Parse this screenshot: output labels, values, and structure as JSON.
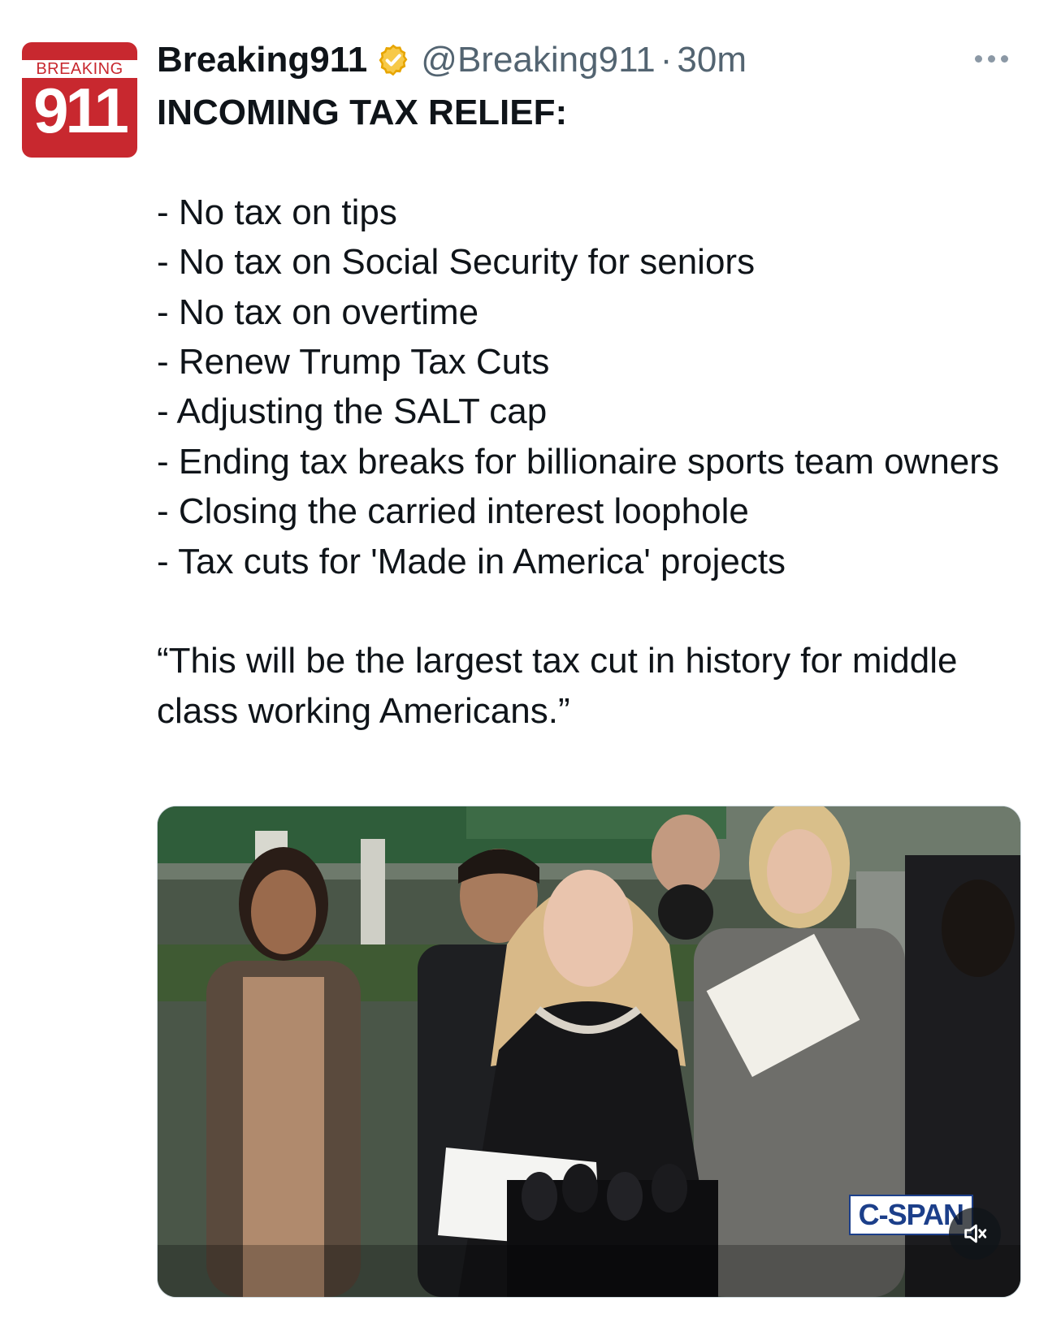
{
  "author": {
    "avatar_top": "BREAKING",
    "avatar_number": "911",
    "display_name": "Breaking911",
    "handle": "@Breaking911",
    "separator": "·",
    "time": "30m",
    "verified_color": "#f2b600"
  },
  "tweet": {
    "headline": "INCOMING TAX RELIEF:",
    "items": [
      "- No tax on tips",
      "- No tax on Social Security for seniors",
      "- No tax on overtime",
      "- Renew Trump Tax Cuts",
      "- Adjusting the SALT cap",
      "- Ending tax breaks for billionaire sports team owners",
      "- Closing the carried interest loophole",
      "- Tax cuts for 'Made in America' projects"
    ],
    "quote": "“This will be the largest tax cut in history for middle class working Americans.”"
  },
  "media": {
    "watermark": "C-SPAN",
    "mute_icon": "speaker-muted-icon"
  },
  "icons": {
    "more": "more-options-icon",
    "verified": "verified-badge-icon"
  }
}
